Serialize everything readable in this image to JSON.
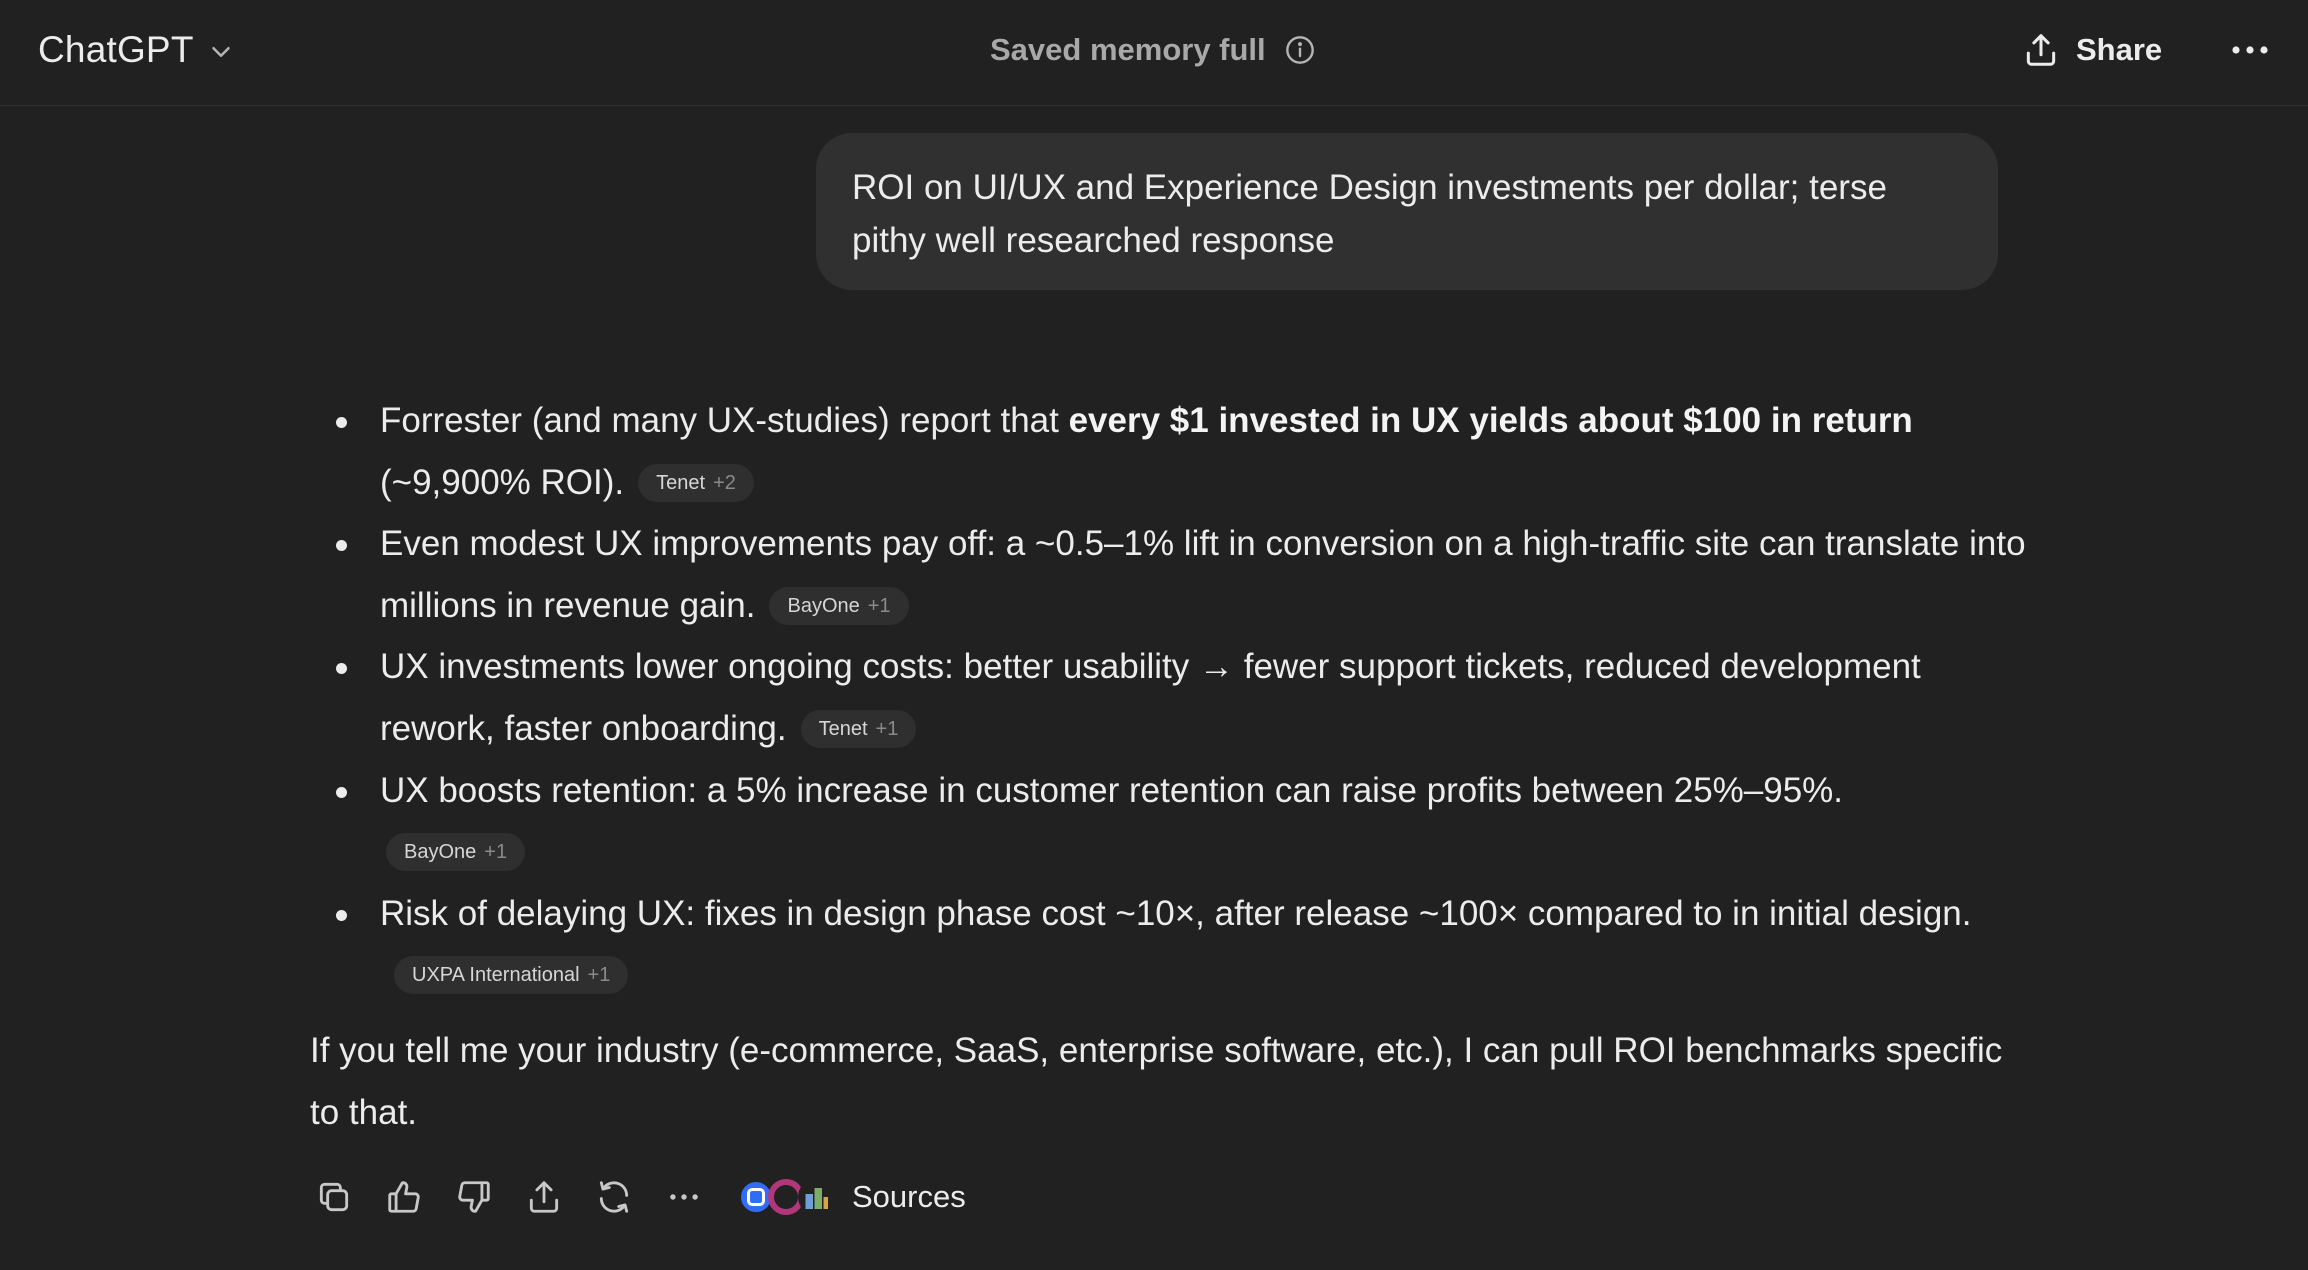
{
  "header": {
    "model_name": "ChatGPT",
    "memory_status": "Saved memory full",
    "share_label": "Share"
  },
  "user_message": {
    "text": "ROI on UI/UX and Experience Design investments per dollar; terse pithy well researched response"
  },
  "assistant_message": {
    "bullets": [
      {
        "text_before": "Forrester (and many UX-studies) report that ",
        "text_bold": "every $1 invested in UX yields about $100 in return",
        "text_after": " (~9,900% ROI).",
        "citation": {
          "name": "Tenet",
          "count": "+2"
        }
      },
      {
        "text": "Even modest UX improvements pay off: a ~0.5–1% lift in conversion on a high-traffic site can translate into millions in revenue gain.",
        "citation": {
          "name": "BayOne",
          "count": "+1"
        }
      },
      {
        "text": "UX investments lower ongoing costs: better usability → fewer support tickets, reduced development rework, faster onboarding.",
        "citation": {
          "name": "Tenet",
          "count": "+1"
        }
      },
      {
        "text": "UX boosts retention: a 5% increase in customer retention can raise profits between 25%–95%.",
        "citation": {
          "name": "BayOne",
          "count": "+1"
        }
      },
      {
        "text": "Risk of delaying UX: fixes in design phase cost ~10×, after release ~100× compared to in initial design.",
        "citation": {
          "name": "UXPA International",
          "count": "+1"
        }
      }
    ],
    "followup": "If you tell me your industry (e-commerce, SaaS, enterprise software, etc.), I can pull ROI benchmarks specific to that."
  },
  "actions": {
    "icons": [
      "copy-icon",
      "thumbs-up-icon",
      "thumbs-down-icon",
      "share-icon",
      "regenerate-icon",
      "more-icon"
    ],
    "sources_label": "Sources",
    "source_favicon_colors": [
      "#2f6df6",
      "#b0387a",
      "#7cae6a"
    ]
  },
  "colors": {
    "background": "#212121",
    "bubble": "#303030",
    "text": "#ececec",
    "muted": "#a8a8a8",
    "chip": "#2f2f2f"
  }
}
